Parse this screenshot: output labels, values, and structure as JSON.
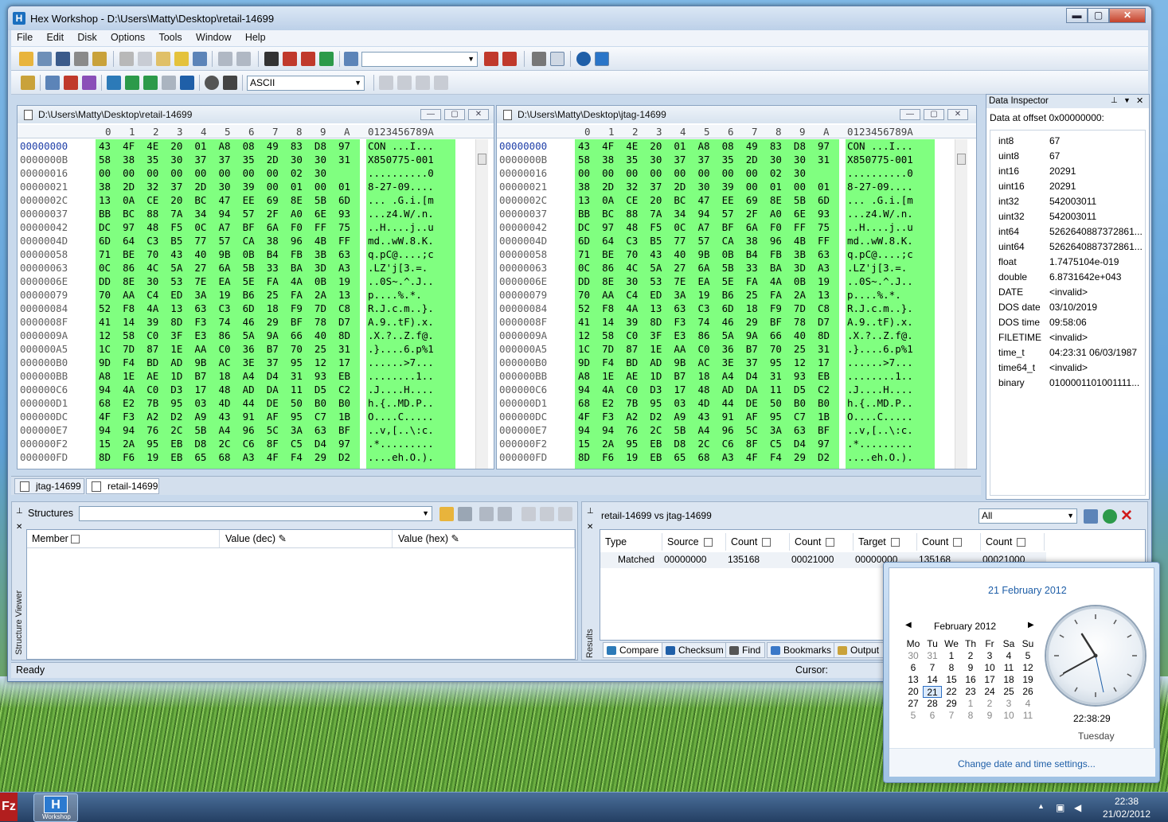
{
  "window": {
    "title": "Hex Workshop - D:\\Users\\Matty\\Desktop\\retail-14699",
    "min": "▬",
    "max": "▢",
    "close": "✕"
  },
  "menu": [
    "File",
    "Edit",
    "Disk",
    "Options",
    "Tools",
    "Window",
    "Help"
  ],
  "toolbar2": {
    "encoding": "ASCII"
  },
  "hex_header": {
    "cols": [
      "0",
      "1",
      "2",
      "3",
      "4",
      "5",
      "6",
      "7",
      "8",
      "9",
      "A"
    ],
    "ascii": "0123456789A"
  },
  "pane_left": {
    "title": "D:\\Users\\Matty\\Desktop\\retail-14699",
    "offsets": [
      "00000000",
      "0000000B",
      "00000016",
      "00000021",
      "0000002C",
      "00000037",
      "00000042",
      "0000004D",
      "00000058",
      "00000063",
      "0000006E",
      "00000079",
      "00000084",
      "0000008F",
      "0000009A",
      "000000A5",
      "000000B0",
      "000000BB",
      "000000C6",
      "000000D1",
      "000000DC",
      "000000E7",
      "000000F2",
      "000000FD"
    ],
    "hex": [
      "43 4F 4E 20 01 A8 08 49 83 D8 97",
      "58 38 35 30 37 37 35 2D 30 30 31",
      "00 00 00 00 00 00 00 00 02 30",
      "38 2D 32 37 2D 30 39 00 01 00 01",
      "13 0A CE 20 BC 47 EE 69 8E 5B 6D",
      "BB BC 88 7A 34 94 57 2F A0 6E 93",
      "DC 97 48 F5 0C A7 BF 6A F0 FF 75",
      "6D 64 C3 B5 77 57 CA 38 96 4B FF",
      "71 BE 70 43 40 9B 0B B4 FB 3B 63",
      "0C 86 4C 5A 27 6A 5B 33 BA 3D A3",
      "DD 8E 30 53 7E EA 5E FA 4A 0B 19",
      "70 AA C4 ED 3A 19 B6 25 FA 2A 13",
      "52 F8 4A 13 63 C3 6D 18 F9 7D C8",
      "41 14 39 8D F3 74 46 29 BF 78 D7",
      "12 58 C0 3F E3 86 5A 9A 66 40 8D",
      "1C 7D 87 1E AA C0 36 B7 70 25 31",
      "9D F4 BD AD 9B AC 3E 37 95 12 17",
      "A8 1E AE 1D B7 18 A4 D4 31 93 EB",
      "94 4A C0 D3 17 48 AD DA 11 D5 C2",
      "68 E2 7B 95 03 4D 44 DE 50 B0 B0",
      "4F F3 A2 D2 A9 43 91 AF 95 C7 1B",
      "94 94 76 2C 5B A4 96 5C 3A 63 BF",
      "15 2A 95 EB D8 2C C6 8F C5 D4 97",
      "8D F6 19 EB 65 68 A3 4F F4 29 D2"
    ],
    "ascii": [
      "CON ...I...",
      "X850775-001",
      "..........0",
      "8-27-09....",
      "... .G.i.[m",
      "...z4.W/.n.",
      "..H....j..u",
      "md..wW.8.K.",
      "q.pC@....;c",
      ".LZ'j[3.=.",
      "..0S~.^.J..",
      "p....%.*.",
      "R.J.c.m..}.",
      "A.9..tF).x.",
      ".X.?..Z.f@.",
      ".}....6.p%1",
      "......>7...",
      "........1..",
      ".J....H....",
      "h.{..MD.P..",
      "O....C.....",
      "..v,[..\\:c.",
      ".*.........",
      "....eh.O.)."
    ]
  },
  "pane_right": {
    "title": "D:\\Users\\Matty\\Desktop\\jtag-14699"
  },
  "inspector": {
    "title": "Data Inspector",
    "offset_label": "Data at offset 0x00000000:",
    "rows": [
      {
        "k": "int8",
        "v": "67"
      },
      {
        "k": "uint8",
        "v": "67"
      },
      {
        "k": "int16",
        "v": "20291"
      },
      {
        "k": "uint16",
        "v": "20291"
      },
      {
        "k": "int32",
        "v": "542003011"
      },
      {
        "k": "uint32",
        "v": "542003011"
      },
      {
        "k": "int64",
        "v": "5262640887372861..."
      },
      {
        "k": "uint64",
        "v": "5262640887372861..."
      },
      {
        "k": "float",
        "v": "1.7475104e-019"
      },
      {
        "k": "double",
        "v": "6.8731642e+043"
      },
      {
        "k": "DATE",
        "v": "<invalid>"
      },
      {
        "k": "DOS date",
        "v": "03/10/2019"
      },
      {
        "k": "DOS time",
        "v": "09:58:06"
      },
      {
        "k": "FILETIME",
        "v": "<invalid>"
      },
      {
        "k": "time_t",
        "v": "04:23:31 06/03/1987"
      },
      {
        "k": "time64_t",
        "v": "<invalid>"
      },
      {
        "k": "binary",
        "v": "0100001101001111..."
      }
    ]
  },
  "doc_tabs": [
    "jtag-14699",
    "retail-14699"
  ],
  "structures": {
    "label": "Structures",
    "side_label": "Structure Viewer",
    "cols": [
      "Member",
      "Value (dec)",
      "Value (hex)"
    ]
  },
  "results": {
    "title": "retail-14699 vs jtag-14699",
    "filter": "All",
    "side_label": "Results",
    "cols": [
      "Type",
      "Source",
      "Count",
      "Count",
      "Target",
      "Count",
      "Count"
    ],
    "row": [
      "Matched",
      "00000000",
      "135168",
      "00021000",
      "00000000",
      "135168",
      "00021000"
    ],
    "tabs": [
      "Compare",
      "Checksum",
      "Find",
      "Bookmarks",
      "Output"
    ]
  },
  "status": {
    "left": "Ready",
    "cursor": "Cursor:"
  },
  "calendar": {
    "title": "21 February 2012",
    "month": "February 2012",
    "weekdays": [
      "Mo",
      "Tu",
      "We",
      "Th",
      "Fr",
      "Sa",
      "Su"
    ],
    "weeks": [
      [
        "30",
        "31",
        "1",
        "2",
        "3",
        "4",
        "5"
      ],
      [
        "6",
        "7",
        "8",
        "9",
        "10",
        "11",
        "12"
      ],
      [
        "13",
        "14",
        "15",
        "16",
        "17",
        "18",
        "19"
      ],
      [
        "20",
        "21",
        "22",
        "23",
        "24",
        "25",
        "26"
      ],
      [
        "27",
        "28",
        "29",
        "1",
        "2",
        "3",
        "4"
      ],
      [
        "5",
        "6",
        "7",
        "8",
        "9",
        "10",
        "11"
      ]
    ],
    "time": "22:38:29",
    "day": "Tuesday",
    "link": "Change date and time settings..."
  },
  "taskbar": {
    "time": "22:38",
    "date": "21/02/2012",
    "fz": "Fz",
    "hw_icon": "H",
    "hw_label": "Workshop"
  }
}
